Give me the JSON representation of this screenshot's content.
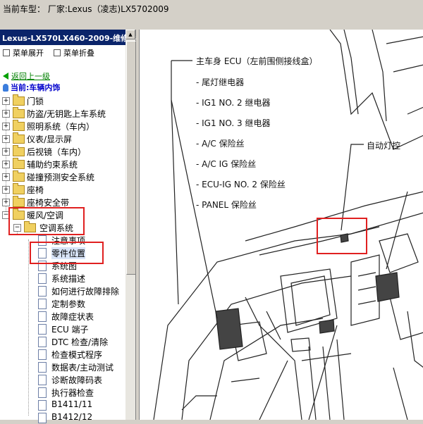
{
  "header": {
    "title": "当前车型：  厂家:Lexus（凌志)LX5702009"
  },
  "left_panel": {
    "title": "Lexus-LX570LX460-2009-维修手",
    "menu_expand": "菜单展开",
    "menu_collapse": "菜单折叠",
    "back_link": "返回上一级",
    "current": "当前:车辆内饰"
  },
  "tree": {
    "folders": [
      "门锁",
      "防盗/无钥匙上车系统",
      "照明系统（车内）",
      "仪表/显示屏",
      "后视镜（车内）",
      "辅助约束系统",
      "碰撞预测安全系统",
      "座椅",
      "座椅安全带",
      "暖风/空调"
    ],
    "subfolder": "空调系统",
    "docs": [
      "注意事项",
      "零件位置",
      "系统图",
      "系统描述",
      "如何进行故障排除",
      "定制参数",
      "故障症状表",
      "ECU 端子",
      "DTC 检查/清除",
      "检查模式程序",
      "数据表/主动测试",
      "诊断故障码表",
      "执行器检查",
      "B1411/11",
      "B1412/12"
    ]
  },
  "diagram": {
    "labels": [
      "主车身 ECU（左前围侧接线盒）",
      "- 尾灯继电器",
      "- IG1 NO. 2 继电器",
      "- IG1 NO. 3 继电器",
      "- A/C 保险丝",
      "- A/C IG 保险丝",
      "- ECU-IG NO. 2 保险丝",
      "- PANEL 保险丝",
      "自动灯控"
    ]
  }
}
